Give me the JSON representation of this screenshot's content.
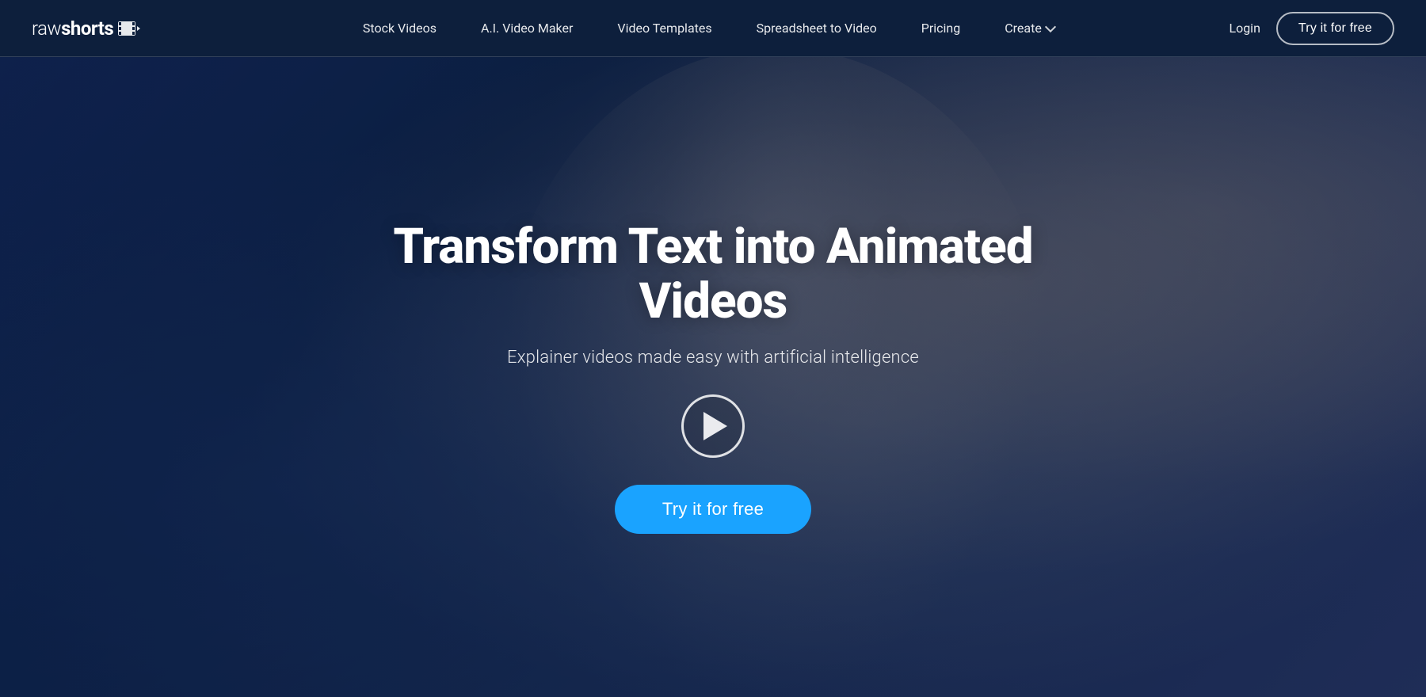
{
  "brand": {
    "logo_raw": "raw",
    "logo_shorts": "shorts",
    "logo_aria": "rawshorts logo"
  },
  "navbar": {
    "links": [
      {
        "id": "stock-videos",
        "label": "Stock Videos",
        "has_arrow": false
      },
      {
        "id": "ai-video-maker",
        "label": "A.I. Video Maker",
        "has_arrow": false
      },
      {
        "id": "video-templates",
        "label": "Video Templates",
        "has_arrow": false
      },
      {
        "id": "spreadsheet-to-video",
        "label": "Spreadsheet to Video",
        "has_arrow": false
      },
      {
        "id": "pricing",
        "label": "Pricing",
        "has_arrow": false
      },
      {
        "id": "create",
        "label": "Create",
        "has_arrow": true
      }
    ],
    "login_label": "Login",
    "try_free_label": "Try it for free"
  },
  "hero": {
    "title": "Transform Text into Animated Videos",
    "subtitle": "Explainer videos made easy with artificial intelligence",
    "play_button_aria": "Play video",
    "cta_label": "Try it for free"
  },
  "colors": {
    "nav_bg": "#0d1f3c",
    "cta_blue": "#1aa3ff",
    "overlay": "rgba(10,26,62,0.65)"
  }
}
